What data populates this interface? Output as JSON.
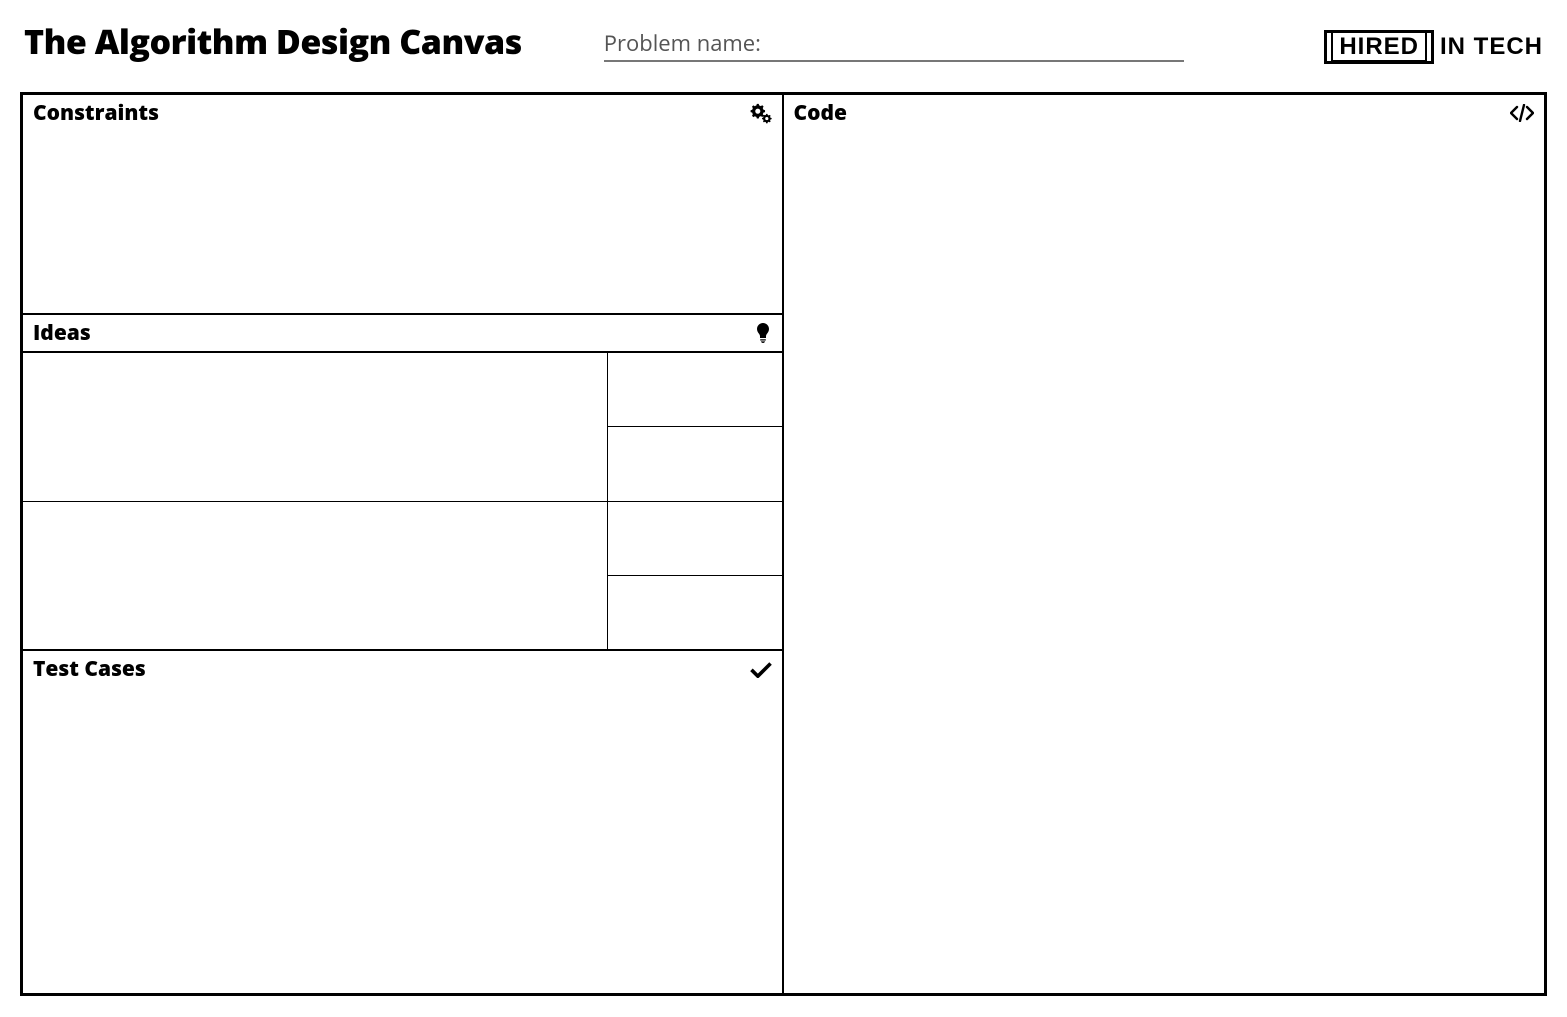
{
  "header": {
    "title": "The Algorithm Design Canvas",
    "problem_name_label": "Problem name:",
    "problem_name_value": ""
  },
  "brand": {
    "boxed": "HIRED",
    "rest": "IN TECH"
  },
  "sections": {
    "constraints": {
      "title": "Constraints",
      "content": ""
    },
    "ideas": {
      "title": "Ideas"
    },
    "test_cases": {
      "title": "Test Cases",
      "content": ""
    },
    "code": {
      "title": "Code",
      "content": ""
    }
  },
  "ideas_rows": [
    {
      "main": "",
      "side_top": "",
      "side_bottom": ""
    },
    {
      "main": "",
      "side_top": "",
      "side_bottom": ""
    }
  ]
}
